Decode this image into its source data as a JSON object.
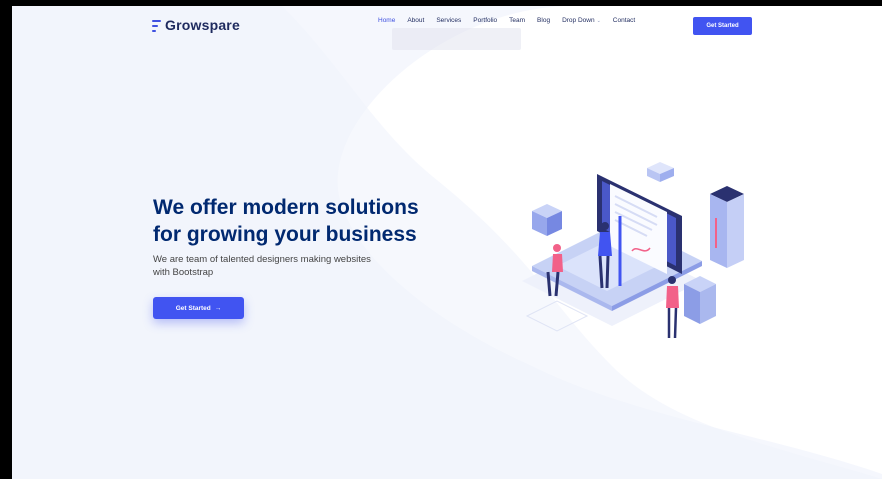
{
  "brand": {
    "name": "Growspare",
    "color": "#012970",
    "accent": "#4154f1"
  },
  "icons": {
    "logo": "menu-lines-icon",
    "dropdown": "chevron-down-icon",
    "arrow": "arrow-right-icon"
  },
  "nav": {
    "items": [
      {
        "label": "Home",
        "active": true
      },
      {
        "label": "About"
      },
      {
        "label": "Services"
      },
      {
        "label": "Portfolio"
      },
      {
        "label": "Team"
      },
      {
        "label": "Blog"
      },
      {
        "label": "Drop Down"
      },
      {
        "label": "Contact"
      }
    ],
    "cta": "Get Started"
  },
  "hero": {
    "title_line1": "We offer modern solutions",
    "title_line2": "for growing your business",
    "subtitle_line1": "We are team of talented designers making websites",
    "subtitle_line2": "with Bootstrap",
    "button": "Get Started",
    "button_arrow": "→"
  }
}
